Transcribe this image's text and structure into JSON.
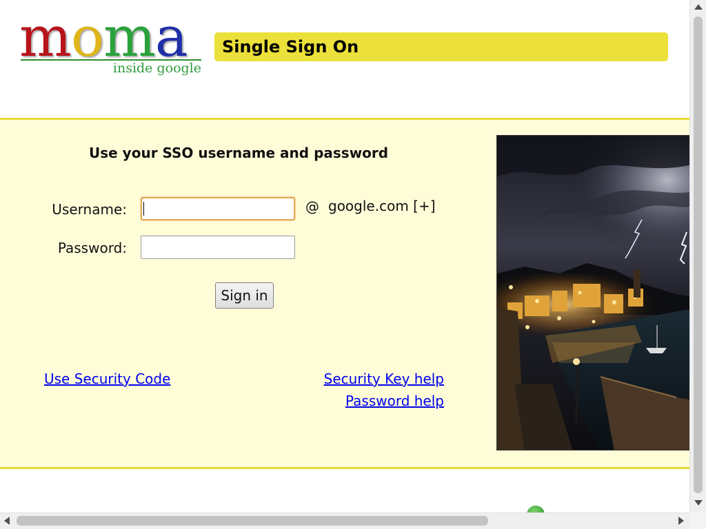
{
  "logo": {
    "letters": [
      {
        "char": "m",
        "color": "#b8141b"
      },
      {
        "char": "o",
        "color": "#e0b51a"
      },
      {
        "char": "m",
        "color": "#2aa23c"
      },
      {
        "char": "a",
        "color": "#1f2fa8"
      }
    ],
    "tagline": "inside google"
  },
  "header": {
    "title": "Single Sign On",
    "bar_color": "#ece03a"
  },
  "login": {
    "heading": "Use your SSO username and password",
    "username_label": "Username:",
    "username_value": "",
    "password_label": "Password:",
    "password_value": "",
    "domain_at": "@",
    "domain": "google.com [+]",
    "signin_label": "Sign in"
  },
  "links": {
    "security_code": "Use Security Code",
    "security_key_help": "Security Key help",
    "password_help": "Password help"
  },
  "photo": {
    "subject": "lakeside town at night under lightning storm"
  },
  "colors": {
    "panel_bg": "#fffdd8",
    "panel_border": "#e6da37",
    "link": "#0000ee"
  }
}
